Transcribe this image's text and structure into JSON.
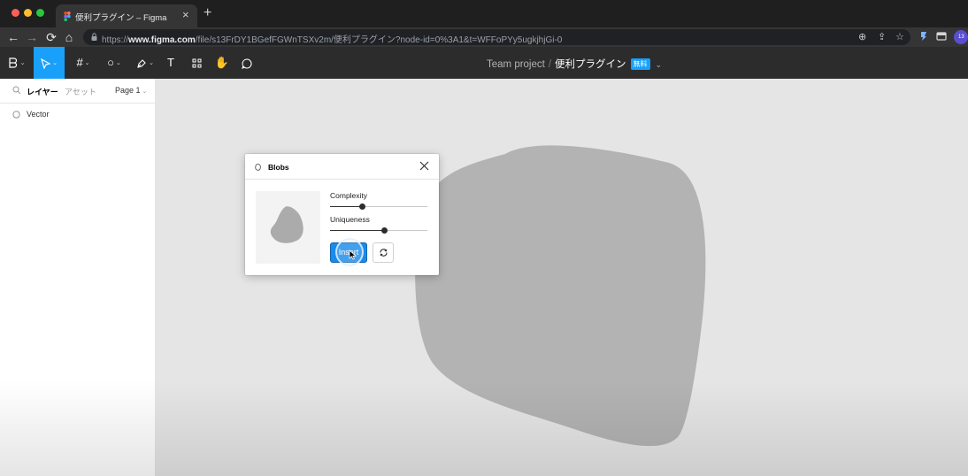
{
  "browser": {
    "tab_title": "便利プラグイン – Figma",
    "tab_close": "×",
    "new_tab": "+",
    "url_prefix": "https://",
    "url_host": "www.figma.com",
    "url_path": "/file/s13FrDY1BGefFGWnTSXv2m/便利プラグイン?node-id=0%3A1&t=WFFoPYy5ugkjhjGi-0",
    "extension_badge": "13"
  },
  "toolbar": {
    "team": "Team project",
    "separator": "/",
    "file_name": "便利プラグイン",
    "plan_badge": "無料",
    "text_tool": "T"
  },
  "left_panel": {
    "layers_tab": "レイヤー",
    "assets_tab": "アセット",
    "page": "Page 1",
    "layers": [
      {
        "label": "Vector"
      }
    ]
  },
  "plugin": {
    "title": "Blobs",
    "sliders": [
      {
        "label": "Complexity",
        "value": 0.33
      },
      {
        "label": "Uniqueness",
        "value": 0.55
      }
    ],
    "insert_label": "Insert"
  },
  "colors": {
    "accent": "#18a0fb",
    "toolbar": "#2c2c2c",
    "canvas": "#e5e5e5",
    "blob": "#b3b3b3"
  }
}
